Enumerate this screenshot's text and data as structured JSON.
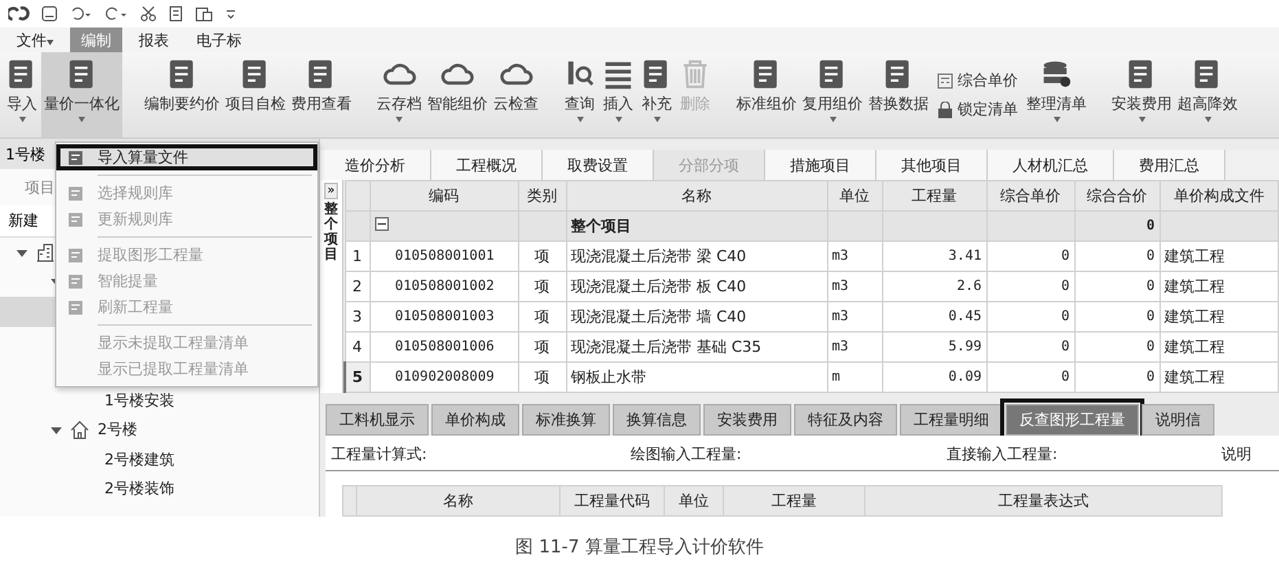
{
  "menu": [
    {
      "label": "文件",
      "dropdown": true,
      "selected": false
    },
    {
      "label": "编制",
      "dropdown": false,
      "selected": true
    },
    {
      "label": "报表",
      "dropdown": false,
      "selected": false
    },
    {
      "label": "电子标",
      "dropdown": false,
      "selected": false
    }
  ],
  "ribbon": {
    "groups": [
      {
        "buttons": [
          {
            "kind": "large",
            "label": "导入",
            "dropdown": true,
            "pressed": false,
            "disabled": false
          },
          {
            "kind": "large",
            "label": "量价一体化",
            "dropdown": true,
            "pressed": true,
            "disabled": false
          }
        ]
      },
      {
        "buttons": [
          {
            "kind": "large",
            "label": "编制要约价",
            "dropdown": false,
            "pressed": false,
            "disabled": false
          },
          {
            "kind": "large",
            "label": "项目自检",
            "dropdown": false,
            "pressed": false,
            "disabled": false
          },
          {
            "kind": "large",
            "label": "费用查看",
            "dropdown": false,
            "pressed": false,
            "disabled": false
          }
        ]
      },
      {
        "buttons": [
          {
            "kind": "large",
            "label": "云存档",
            "dropdown": true,
            "pressed": false,
            "disabled": false
          },
          {
            "kind": "large",
            "label": "智能组价",
            "dropdown": false,
            "pressed": false,
            "disabled": false
          },
          {
            "kind": "large",
            "label": "云检查",
            "dropdown": false,
            "pressed": false,
            "disabled": false
          }
        ]
      },
      {
        "buttons": [
          {
            "kind": "large",
            "label": "查询",
            "dropdown": true,
            "pressed": false,
            "disabled": false
          },
          {
            "kind": "large",
            "label": "插入",
            "dropdown": true,
            "pressed": false,
            "disabled": false
          },
          {
            "kind": "large",
            "label": "补充",
            "dropdown": true,
            "pressed": false,
            "disabled": false
          },
          {
            "kind": "large",
            "label": "删除",
            "dropdown": false,
            "pressed": false,
            "disabled": true
          }
        ]
      },
      {
        "buttons": [
          {
            "kind": "large",
            "label": "标准组价",
            "dropdown": false,
            "pressed": false,
            "disabled": false
          },
          {
            "kind": "large",
            "label": "复用组价",
            "dropdown": true,
            "pressed": false,
            "disabled": false
          },
          {
            "kind": "large",
            "label": "替换数据",
            "dropdown": false,
            "pressed": false,
            "disabled": false
          },
          {
            "kind": "stack",
            "items": [
              {
                "label": "综合单价"
              },
              {
                "label": "锁定清单"
              }
            ]
          },
          {
            "kind": "large",
            "label": "整理清单",
            "dropdown": true,
            "pressed": false,
            "disabled": false
          }
        ]
      },
      {
        "buttons": [
          {
            "kind": "large",
            "label": "安装费用",
            "dropdown": true,
            "pressed": false,
            "disabled": false
          },
          {
            "kind": "large",
            "label": "超高降效",
            "dropdown": true,
            "pressed": false,
            "disabled": false
          }
        ]
      }
    ]
  },
  "left_panel": {
    "tab": "1号楼",
    "section": "项目",
    "new_button": "新建",
    "tree": [
      {
        "expanded": true,
        "selected": false,
        "children": [
          {
            "expanded": true,
            "selected": false,
            "children": [
              {
                "selected": true
              },
              {
                "selected": false
              },
              {
                "selected": false
              },
              {
                "label": "1号楼安装",
                "selected": false
              }
            ]
          },
          {
            "label": "2号楼",
            "expanded": true,
            "selected": false,
            "children": [
              {
                "label": "2号楼建筑",
                "selected": false
              },
              {
                "label": "2号楼装饰",
                "selected": false
              }
            ]
          }
        ]
      }
    ]
  },
  "context_menu": {
    "items": [
      {
        "kind": "item",
        "label": "导入算量文件",
        "disabled": false,
        "highlighted": true
      },
      {
        "kind": "separator"
      },
      {
        "kind": "item",
        "label": "选择规则库",
        "disabled": true,
        "highlighted": false
      },
      {
        "kind": "item",
        "label": "更新规则库",
        "disabled": true,
        "highlighted": false
      },
      {
        "kind": "separator"
      },
      {
        "kind": "item",
        "label": "提取图形工程量",
        "disabled": true,
        "highlighted": false
      },
      {
        "kind": "item",
        "label": "智能提量",
        "disabled": true,
        "highlighted": false
      },
      {
        "kind": "item",
        "label": "刷新工程量",
        "disabled": true,
        "highlighted": false
      },
      {
        "kind": "separator"
      },
      {
        "kind": "item",
        "label": "显示未提取工程量清单",
        "disabled": true,
        "highlighted": false
      },
      {
        "kind": "item",
        "label": "显示已提取工程量清单",
        "disabled": true,
        "highlighted": false
      }
    ]
  },
  "tabs": [
    {
      "label": "造价分析",
      "selected": false
    },
    {
      "label": "工程概况",
      "selected": false
    },
    {
      "label": "取费设置",
      "selected": false
    },
    {
      "label": "分部分项",
      "selected": true
    },
    {
      "label": "措施项目",
      "selected": false
    },
    {
      "label": "其他项目",
      "selected": false
    },
    {
      "label": "人材机汇总",
      "selected": false
    },
    {
      "label": "费用汇总",
      "selected": false
    }
  ],
  "side_panel": {
    "expand_button": "»",
    "label": "整个项目"
  },
  "table": {
    "columns": [
      "编码",
      "类别",
      "名称",
      "单位",
      "工程量",
      "综合单价",
      "综合合价",
      "单价构成文件"
    ],
    "group_row": {
      "name": "整个项目",
      "total": "0",
      "expanded": true
    },
    "rows": [
      {
        "number": "1",
        "code": "010508001001",
        "type": "项",
        "name": "现浇混凝土后浇带 梁 C40",
        "unit": "m3",
        "quantity": "3.41",
        "unit_price": "0",
        "total": "0",
        "price_file": "建筑工程",
        "selected": false
      },
      {
        "number": "2",
        "code": "010508001002",
        "type": "项",
        "name": "现浇混凝土后浇带 板 C40",
        "unit": "m3",
        "quantity": "2.6",
        "unit_price": "0",
        "total": "0",
        "price_file": "建筑工程",
        "selected": false
      },
      {
        "number": "3",
        "code": "010508001003",
        "type": "项",
        "name": "现浇混凝土后浇带 墙 C40",
        "unit": "m3",
        "quantity": "0.45",
        "unit_price": "0",
        "total": "0",
        "price_file": "建筑工程",
        "selected": false
      },
      {
        "number": "4",
        "code": "010508001006",
        "type": "项",
        "name": "现浇混凝土后浇带 基础 C35",
        "unit": "m3",
        "quantity": "5.99",
        "unit_price": "0",
        "total": "0",
        "price_file": "建筑工程",
        "selected": false
      },
      {
        "number": "5",
        "code": "010902008009",
        "type": "项",
        "name": "钢板止水带",
        "unit": "m",
        "quantity": "0.09",
        "unit_price": "0",
        "total": "0",
        "price_file": "建筑工程",
        "selected": true
      }
    ]
  },
  "detail": {
    "tabs": [
      {
        "label": "工料机显示",
        "selected": false,
        "highlighted": false
      },
      {
        "label": "单价构成",
        "selected": false,
        "highlighted": false
      },
      {
        "label": "标准换算",
        "selected": false,
        "highlighted": false
      },
      {
        "label": "换算信息",
        "selected": false,
        "highlighted": false
      },
      {
        "label": "安装费用",
        "selected": false,
        "highlighted": false
      },
      {
        "label": "特征及内容",
        "selected": false,
        "highlighted": false
      },
      {
        "label": "工程量明细",
        "selected": false,
        "highlighted": false
      },
      {
        "label": "反查图形工程量",
        "selected": true,
        "highlighted": true
      },
      {
        "label": "说明信",
        "selected": false,
        "highlighted": false
      }
    ],
    "fields": [
      "工程量计算式:",
      "绘图输入工程量:",
      "直接输入工程量:",
      "说明"
    ],
    "columns": [
      "名称",
      "工程量代码",
      "单位",
      "工程量",
      "工程量表达式"
    ]
  },
  "caption": "图 11-7   算量工程导入计价软件"
}
